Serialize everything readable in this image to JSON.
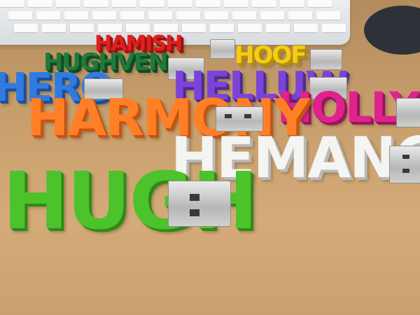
{
  "photo": {
    "drives": [
      {
        "name": "HUGH",
        "color": "#4cc22b",
        "shadow": "#2f8a17"
      },
      {
        "name": "HEMANGY",
        "color": "#f4f4f2",
        "shadow": "#b9b9b5"
      },
      {
        "name": "HARMONY",
        "color": "#ff7f27",
        "shadow": "#c45410"
      },
      {
        "name": "HOLLY",
        "color": "#e0228e",
        "shadow": "#9c1562"
      },
      {
        "name": "HELLUW",
        "color": "#7a45d6",
        "shadow": "#4f2a95"
      },
      {
        "name": "HERO",
        "color": "#2f7be0",
        "shadow": "#1b4f9c"
      },
      {
        "name": "HUGHVEN",
        "color": "#1f7a3a",
        "shadow": "#114a22"
      },
      {
        "name": "HAMISH",
        "color": "#e0201e",
        "shadow": "#981211"
      },
      {
        "name": "HOOF",
        "color": "#f5cc16",
        "shadow": "#b38f07"
      }
    ]
  }
}
